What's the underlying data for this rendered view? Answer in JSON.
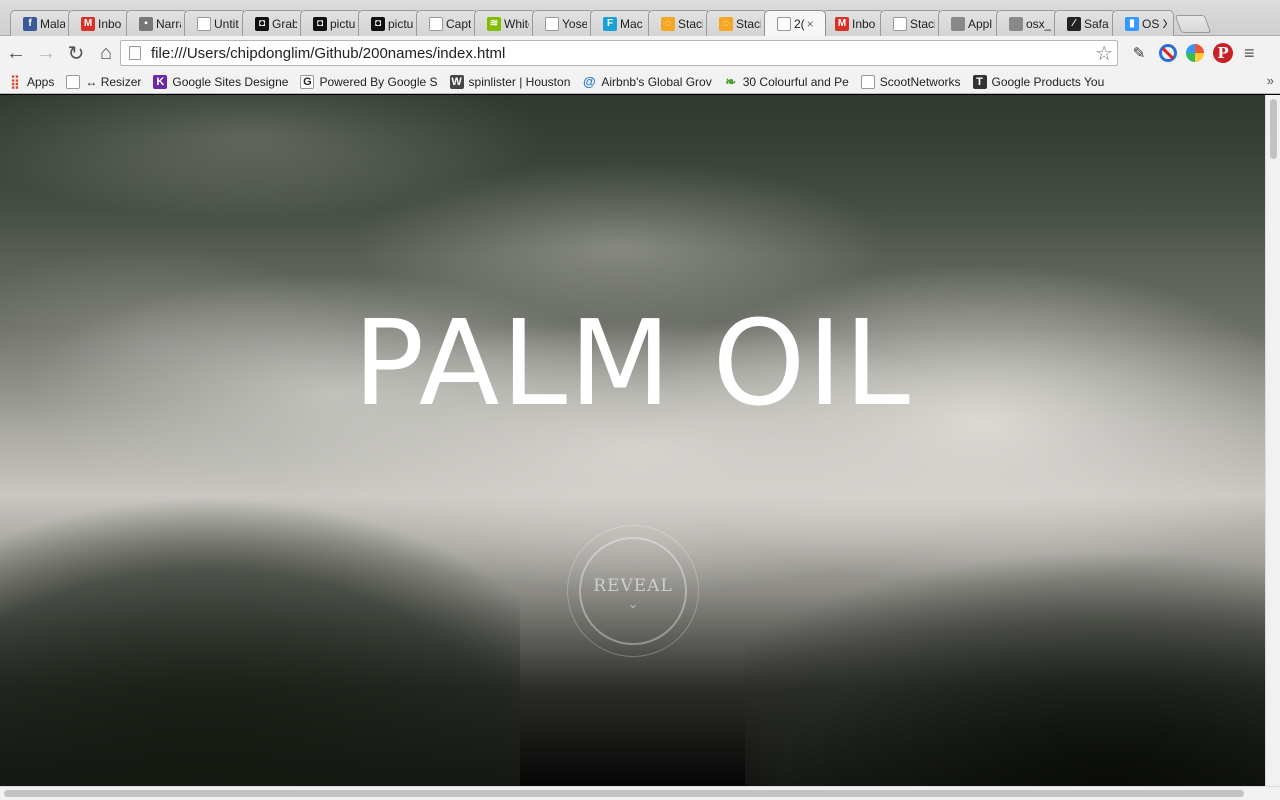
{
  "browser": {
    "tabs": [
      {
        "label": "Mala",
        "icon": "facebook-icon",
        "color": "#3b5998",
        "glyph": "f"
      },
      {
        "label": "Inbo",
        "icon": "gmail-icon",
        "color": "#d93025",
        "glyph": "M"
      },
      {
        "label": "Narra",
        "icon": "contact-icon",
        "color": "#777777",
        "glyph": "▪"
      },
      {
        "label": "Untit",
        "icon": "document-icon",
        "color": "#ffffff",
        "glyph": ""
      },
      {
        "label": "Grab",
        "icon": "camera-icon",
        "color": "#111111",
        "glyph": "◘"
      },
      {
        "label": "pictu",
        "icon": "camera-icon",
        "color": "#111111",
        "glyph": "◘"
      },
      {
        "label": "pictu",
        "icon": "camera-icon",
        "color": "#111111",
        "glyph": "◘"
      },
      {
        "label": "Capt",
        "icon": "document-icon",
        "color": "#ffffff",
        "glyph": ""
      },
      {
        "label": "White",
        "icon": "spotify-icon",
        "color": "#84bd00",
        "glyph": "≋"
      },
      {
        "label": "Yose",
        "icon": "document-icon",
        "color": "#ffffff",
        "glyph": ""
      },
      {
        "label": "Mac",
        "icon": "flipboard-icon",
        "color": "#1aa1d6",
        "glyph": "F"
      },
      {
        "label": "Stack",
        "icon": "stackoverflow-icon",
        "color": "#f5a623",
        "glyph": "◌"
      },
      {
        "label": "Stack",
        "icon": "stackoverflow-icon",
        "color": "#f5a623",
        "glyph": "◌"
      },
      {
        "label": "2(",
        "icon": "document-icon",
        "color": "#ffffff",
        "glyph": "",
        "active": true
      },
      {
        "label": "Inbo",
        "icon": "gmail-icon",
        "color": "#d93025",
        "glyph": "M"
      },
      {
        "label": "Stack",
        "icon": "document-icon",
        "color": "#ffffff",
        "glyph": ""
      },
      {
        "label": "Appl",
        "icon": "apple-icon",
        "color": "#888888",
        "glyph": ""
      },
      {
        "label": "osx_",
        "icon": "apple-icon",
        "color": "#888888",
        "glyph": ""
      },
      {
        "label": "Safar",
        "icon": "safari-icon",
        "color": "#222222",
        "glyph": "⁄"
      },
      {
        "label": "OS X",
        "icon": "pin-icon",
        "color": "#3399ff",
        "glyph": "▮"
      }
    ],
    "tab_close": "×",
    "nav": {
      "back": "←",
      "forward": "→",
      "reload": "↻",
      "home": "⌂"
    },
    "url": "file:///Users/chipdonglim/Github/200names/index.html",
    "star": "☆",
    "menu": "≡",
    "pinterest_glyph": "P",
    "dropper_glyph": "✎",
    "bookmarks": [
      {
        "label": "Apps",
        "icon": "apps-grid-icon",
        "glyph": "⣿",
        "color": "#e0452b"
      },
      {
        "label": "↔ Resizer",
        "icon": "document-icon",
        "glyph": "",
        "color": "#ffffff"
      },
      {
        "label": "Google Sites Designe",
        "icon": "k-icon",
        "glyph": "K",
        "color": "#6a2aa8"
      },
      {
        "label": "Powered By Google S",
        "icon": "g-icon",
        "glyph": "G",
        "color": "#ffffff"
      },
      {
        "label": "spinlister | Houston",
        "icon": "wordpress-icon",
        "glyph": "W",
        "color": "#464646"
      },
      {
        "label": "Airbnb's Global Grov",
        "icon": "airbnb-icon",
        "glyph": "@",
        "color": "#2a7dd1"
      },
      {
        "label": "30 Colourful and Pe",
        "icon": "leaf-icon",
        "glyph": "❧",
        "color": "#4aa02c"
      },
      {
        "label": "ScootNetworks",
        "icon": "document-icon",
        "glyph": "",
        "color": "#ffffff"
      },
      {
        "label": "Google Products You",
        "icon": "t-icon",
        "glyph": "T",
        "color": "#333333"
      }
    ],
    "bookmarks_more": "»"
  },
  "page": {
    "title": "PALM OIL",
    "reveal_label": "REVEAL",
    "reveal_chevron": "⌄"
  }
}
